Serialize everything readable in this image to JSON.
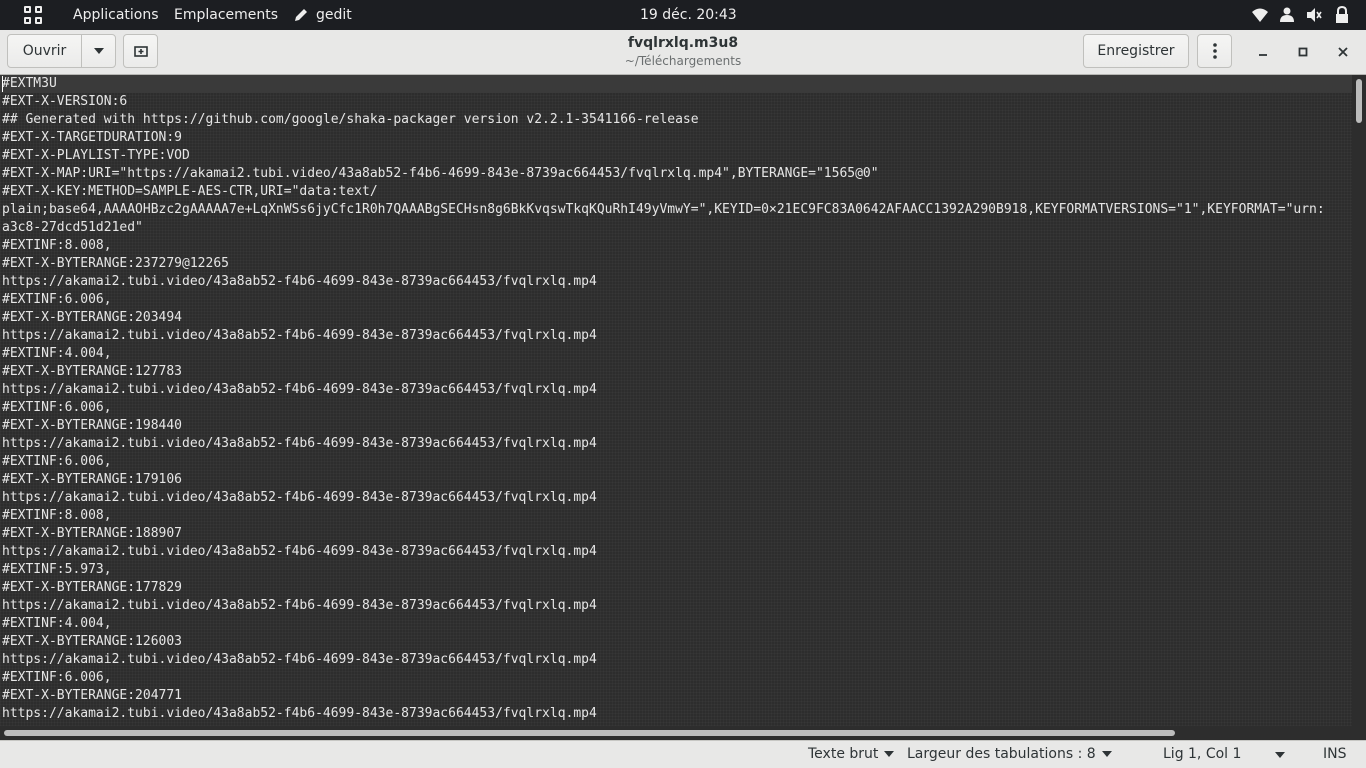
{
  "topbar": {
    "activities_icon": "apps-grid-icon",
    "applications": "Applications",
    "places": "Emplacements",
    "app_name": "gedit",
    "clock": "19 déc.  20:43",
    "tray_icons": [
      "wifi-icon",
      "user-icon",
      "volume-muted-icon",
      "lock-icon"
    ]
  },
  "header": {
    "open_label": "Ouvrir",
    "title": "fvqlrxlq.m3u8",
    "subtitle": "~/Téléchargements",
    "save_label": "Enregistrer"
  },
  "editor": {
    "lines": [
      "#EXTM3U",
      "#EXT-X-VERSION:6",
      "## Generated with https://github.com/google/shaka-packager version v2.2.1-3541166-release",
      "#EXT-X-TARGETDURATION:9",
      "#EXT-X-PLAYLIST-TYPE:VOD",
      "#EXT-X-MAP:URI=\"https://akamai2.tubi.video/43a8ab52-f4b6-4699-843e-8739ac664453/fvqlrxlq.mp4\",BYTERANGE=\"1565@0\"",
      "#EXT-X-KEY:METHOD=SAMPLE-AES-CTR,URI=\"data:text/",
      "plain;base64,AAAAOHBzc2gAAAAA7e+LqXnWSs6jyCfc1R0h7QAAABgSECHsn8g6BkKvqswTkqKQuRhI49yVmwY=\",KEYID=0×21EC9FC83A0642AFAACC1392A290B918,KEYFORMATVERSIONS=\"1\",KEYFORMAT=\"urn:",
      "a3c8-27dcd51d21ed\"",
      "#EXTINF:8.008,",
      "#EXT-X-BYTERANGE:237279@12265",
      "https://akamai2.tubi.video/43a8ab52-f4b6-4699-843e-8739ac664453/fvqlrxlq.mp4",
      "#EXTINF:6.006,",
      "#EXT-X-BYTERANGE:203494",
      "https://akamai2.tubi.video/43a8ab52-f4b6-4699-843e-8739ac664453/fvqlrxlq.mp4",
      "#EXTINF:4.004,",
      "#EXT-X-BYTERANGE:127783",
      "https://akamai2.tubi.video/43a8ab52-f4b6-4699-843e-8739ac664453/fvqlrxlq.mp4",
      "#EXTINF:6.006,",
      "#EXT-X-BYTERANGE:198440",
      "https://akamai2.tubi.video/43a8ab52-f4b6-4699-843e-8739ac664453/fvqlrxlq.mp4",
      "#EXTINF:6.006,",
      "#EXT-X-BYTERANGE:179106",
      "https://akamai2.tubi.video/43a8ab52-f4b6-4699-843e-8739ac664453/fvqlrxlq.mp4",
      "#EXTINF:8.008,",
      "#EXT-X-BYTERANGE:188907",
      "https://akamai2.tubi.video/43a8ab52-f4b6-4699-843e-8739ac664453/fvqlrxlq.mp4",
      "#EXTINF:5.973,",
      "#EXT-X-BYTERANGE:177829",
      "https://akamai2.tubi.video/43a8ab52-f4b6-4699-843e-8739ac664453/fvqlrxlq.mp4",
      "#EXTINF:4.004,",
      "#EXT-X-BYTERANGE:126003",
      "https://akamai2.tubi.video/43a8ab52-f4b6-4699-843e-8739ac664453/fvqlrxlq.mp4",
      "#EXTINF:6.006,",
      "#EXT-X-BYTERANGE:204771",
      "https://akamai2.tubi.video/43a8ab52-f4b6-4699-843e-8739ac664453/fvqlrxlq.mp4"
    ]
  },
  "statusbar": {
    "language": "Texte brut",
    "tab_width": "Largeur des tabulations : 8",
    "position": "Lig 1, Col 1",
    "mode": "INS"
  }
}
